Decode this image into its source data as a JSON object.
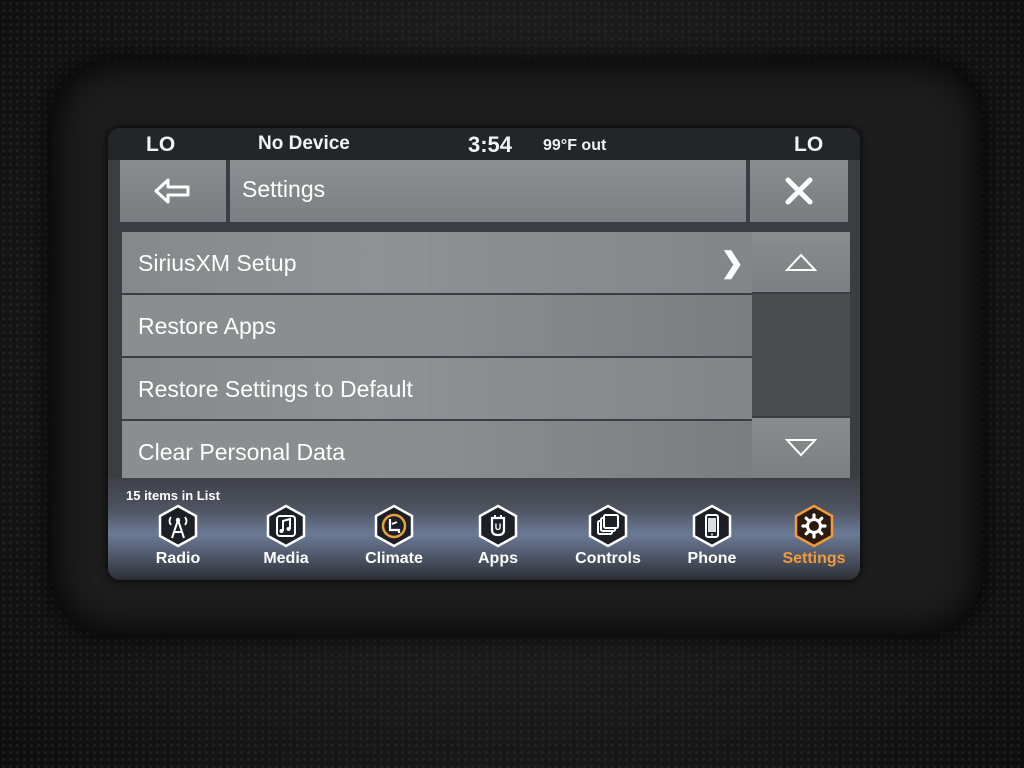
{
  "status": {
    "left_temp": "LO",
    "device": "No Device",
    "time": "3:54",
    "outside_temp": "99°F out",
    "right_temp": "LO"
  },
  "header": {
    "title": "Settings"
  },
  "list": {
    "items": [
      {
        "label": "SiriusXM Setup",
        "has_chevron": true
      },
      {
        "label": "Restore Apps"
      },
      {
        "label": "Restore Settings to Default"
      },
      {
        "label": "Clear Personal Data"
      }
    ],
    "count_text": "15 items in List"
  },
  "nav": {
    "items": [
      {
        "label": "Radio",
        "icon": "radio-tower-icon"
      },
      {
        "label": "Media",
        "icon": "music-note-icon"
      },
      {
        "label": "Climate",
        "icon": "climate-seat-icon"
      },
      {
        "label": "Apps",
        "icon": "apps-icon"
      },
      {
        "label": "Controls",
        "icon": "controls-icon"
      },
      {
        "label": "Phone",
        "icon": "phone-icon"
      },
      {
        "label": "Settings",
        "icon": "gear-icon",
        "active": true
      }
    ],
    "active_color": "#f39a3a"
  }
}
